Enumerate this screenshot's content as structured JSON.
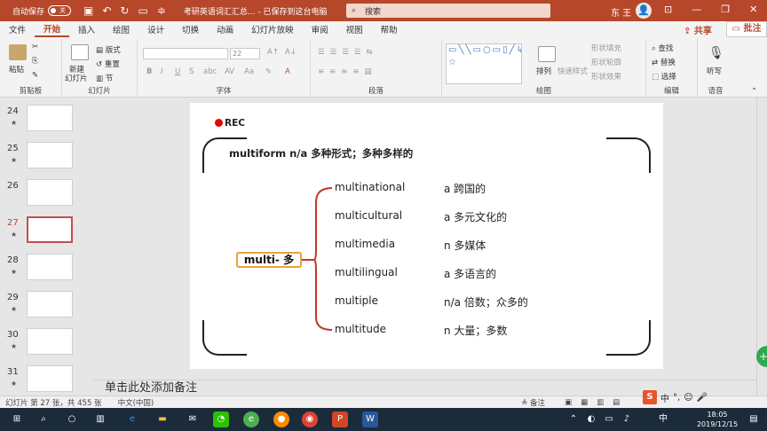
{
  "titlebar": {
    "autosave_label": "自动保存",
    "autosave_state": "关",
    "doc_title": "考研英语词汇汇总... - 已保存到这台电脑",
    "search_placeholder": "搜索",
    "user_name": "东 王",
    "accent_color": "#b7472a"
  },
  "menu": {
    "tabs": [
      "文件",
      "开始",
      "插入",
      "绘图",
      "设计",
      "切换",
      "动画",
      "幻灯片放映",
      "审阅",
      "视图",
      "帮助"
    ],
    "active_tab": "开始",
    "share_label": "共享",
    "comment_label": "批注"
  },
  "ribbon": {
    "clipboard": {
      "paste": "粘贴",
      "label": "剪贴板"
    },
    "slides": {
      "new_slide": "新建",
      "new_slide2": "幻灯片",
      "layout": "版式",
      "reset": "重置",
      "section": "节",
      "label": "幻灯片"
    },
    "font": {
      "font_size": "22",
      "label": "字体"
    },
    "paragraph": {
      "label": "段落"
    },
    "drawing": {
      "arrange": "排列",
      "quick_styles": "快速样式",
      "shape_fill": "形状填充",
      "shape_outline": "形状轮廓",
      "shape_effects": "形状效果",
      "label": "绘图"
    },
    "editing": {
      "find": "查找",
      "replace": "替换",
      "select": "选择",
      "label": "编辑"
    },
    "voice": {
      "dictate": "听写",
      "label": "语音"
    }
  },
  "thumbnails": [
    {
      "num": "24",
      "star": "★"
    },
    {
      "num": "25",
      "star": "★"
    },
    {
      "num": "26",
      "star": ""
    },
    {
      "num": "27",
      "star": "★",
      "selected": true
    },
    {
      "num": "28",
      "star": "★"
    },
    {
      "num": "29",
      "star": "★"
    },
    {
      "num": "30",
      "star": "★"
    },
    {
      "num": "31",
      "star": "★"
    }
  ],
  "slide": {
    "rec": "REC",
    "headline": "multiform  n/a 多种形式；多种多样的",
    "root": "multi-  多",
    "items": [
      {
        "word": "multinational",
        "pos": "a  跨国的"
      },
      {
        "word": "multicultural",
        "pos": "a  多元文化的"
      },
      {
        "word": "multimedia",
        "pos": "n  多媒体"
      },
      {
        "word": "multilingual",
        "pos": "a  多语言的"
      },
      {
        "word": "multiple",
        "pos": "n/a  倍数；众多的"
      },
      {
        "word": "multitude",
        "pos": "n  大量；多数"
      }
    ]
  },
  "notes_placeholder": "单击此处添加备注",
  "status": {
    "slide_info": "幻灯片 第 27 张，共 455 张",
    "language": "中文(中国)",
    "notes_btn": "备注",
    "ime": "中"
  },
  "clock": {
    "time": "18:05",
    "date": "2019/12/15"
  }
}
